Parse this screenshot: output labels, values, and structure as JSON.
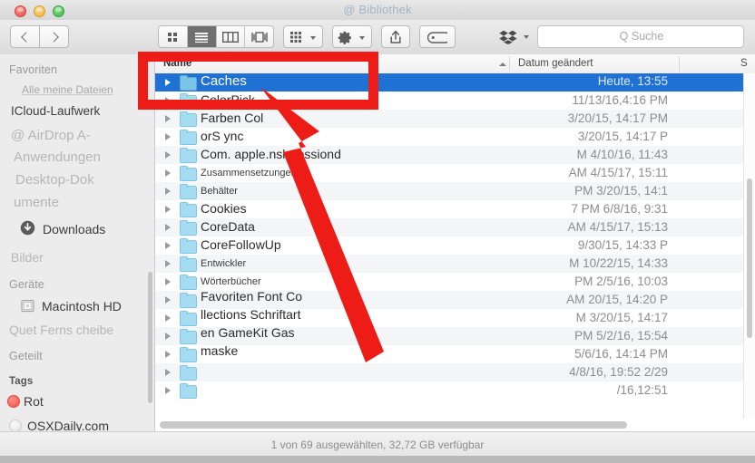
{
  "window": {
    "title": "@ Bibliothek",
    "traffic_lights": [
      "close",
      "minimize",
      "maximize"
    ]
  },
  "toolbar": {
    "back_label": "Zurück",
    "forward_label": "Vorwärts",
    "view_modes": [
      {
        "name": "icon-view",
        "active": false
      },
      {
        "name": "list-view",
        "active": true
      },
      {
        "name": "column-view",
        "active": false
      },
      {
        "name": "coverflow-view",
        "active": false
      }
    ],
    "arrange_label": "Anordnen",
    "action_label": "Aktion",
    "share_label": "Teilen",
    "tag_label": "Tags",
    "dropbox_label": "Dropbox"
  },
  "search": {
    "placeholder": "Q Suche",
    "value": ""
  },
  "sidebar": {
    "sections": [
      {
        "heading": "Favoriten",
        "items": [
          {
            "label": "Alle meine Dateien",
            "style": "dim",
            "icon": "none"
          },
          {
            "label": "ICloud-Laufwerk",
            "style": "normal",
            "icon": "none"
          },
          {
            "label": "@ AirDrop A-",
            "style": "faint",
            "icon": "none"
          },
          {
            "label": "Anwendungen",
            "style": "faint",
            "icon": "none"
          },
          {
            "label": "Desktop-Dok",
            "style": "faint",
            "icon": "none"
          },
          {
            "label": "umente",
            "style": "faint",
            "icon": "none"
          },
          {
            "label": "Downloads",
            "style": "normal",
            "icon": "download-icon"
          },
          {
            "label": "Bilder",
            "style": "faint",
            "icon": "none"
          }
        ]
      },
      {
        "heading": "Geräte",
        "items": [
          {
            "label": "Macintosh HD",
            "style": "normal",
            "icon": "harddisk-icon"
          },
          {
            "label": "Quet Ferns cheibe",
            "style": "faint",
            "icon": "none"
          }
        ]
      },
      {
        "heading": "Geteilt",
        "items": []
      },
      {
        "heading": "Tags",
        "items": [
          {
            "label": "Rot",
            "style": "normal",
            "icon": "tag-dot",
            "color": "#f4564c"
          },
          {
            "label": "OSXDaily.com",
            "style": "normal",
            "icon": "tag-dot",
            "color": "#e6e6e6"
          }
        ]
      }
    ]
  },
  "columns": [
    {
      "label": "Name",
      "sorted": true,
      "sort_direction": "ascending"
    },
    {
      "label": "Datum geändert",
      "sorted": false
    },
    {
      "label": "S",
      "sorted": false
    }
  ],
  "files": [
    {
      "name": "Caches",
      "date": "Heute, 13:55",
      "selected": true,
      "small": false
    },
    {
      "name": "ColorPick",
      "date": "11/13/16,4:16 PM",
      "selected": false,
      "small": false
    },
    {
      "name": "Farben Col",
      "date": "3/20/15, 14:17 PM",
      "selected": false,
      "small": false
    },
    {
      "name": "orS ync",
      "date": "3/20/15, 14:17 P",
      "selected": false,
      "small": false
    },
    {
      "name": "Com. apple.nsl    Sessiond",
      "date": "M 4/10/16, 11:43",
      "selected": false,
      "small": false
    },
    {
      "name": "Zusammensetzungen",
      "date": "AM 4/15/17, 15:11",
      "selected": false,
      "small": true
    },
    {
      "name": "Behälter",
      "date": "PM 3/20/15, 14:1",
      "selected": false,
      "small": true
    },
    {
      "name": "Cookies",
      "date": "7 PM 6/8/16, 9:31",
      "selected": false,
      "small": false
    },
    {
      "name": "CoreData",
      "date": "AM 4/15/17, 15:13",
      "selected": false,
      "small": false
    },
    {
      "name": "CoreFollowUp",
      "date": "9/30/15, 14:33 P",
      "selected": false,
      "small": false
    },
    {
      "name": "Entwickler",
      "date": "M 10/22/15, 14:33",
      "selected": false,
      "small": true
    },
    {
      "name": "Wörterbücher",
      "date": "PM 2/5/16, 10:03",
      "selected": false,
      "small": true
    },
    {
      "name": "Favoriten Font Co",
      "date": "AM 20/15, 14:20 P",
      "selected": false,
      "small": false
    },
    {
      "name": "llections Schriftart",
      "date": "M 3/20/15, 14:17",
      "selected": false,
      "small": false
    },
    {
      "name": "en GameKit Gas",
      "date": "PM 5/2/16, 15:54",
      "selected": false,
      "small": false
    },
    {
      "name": "maske",
      "date": "5/6/16, 14:14 PM",
      "selected": false,
      "small": false
    },
    {
      "name": "",
      "date": "4/8/16, 19:52 2/29",
      "selected": false,
      "small": false
    },
    {
      "name": "",
      "date": "/16,12:51",
      "selected": false,
      "small": false
    }
  ],
  "status": {
    "text": "1 von 69 ausgewählten, 32,72 GB verfügbar"
  },
  "annotation": {
    "color": "#ee1c16",
    "highlight_target": "Caches",
    "shape": "rectangle-and-arrow"
  }
}
